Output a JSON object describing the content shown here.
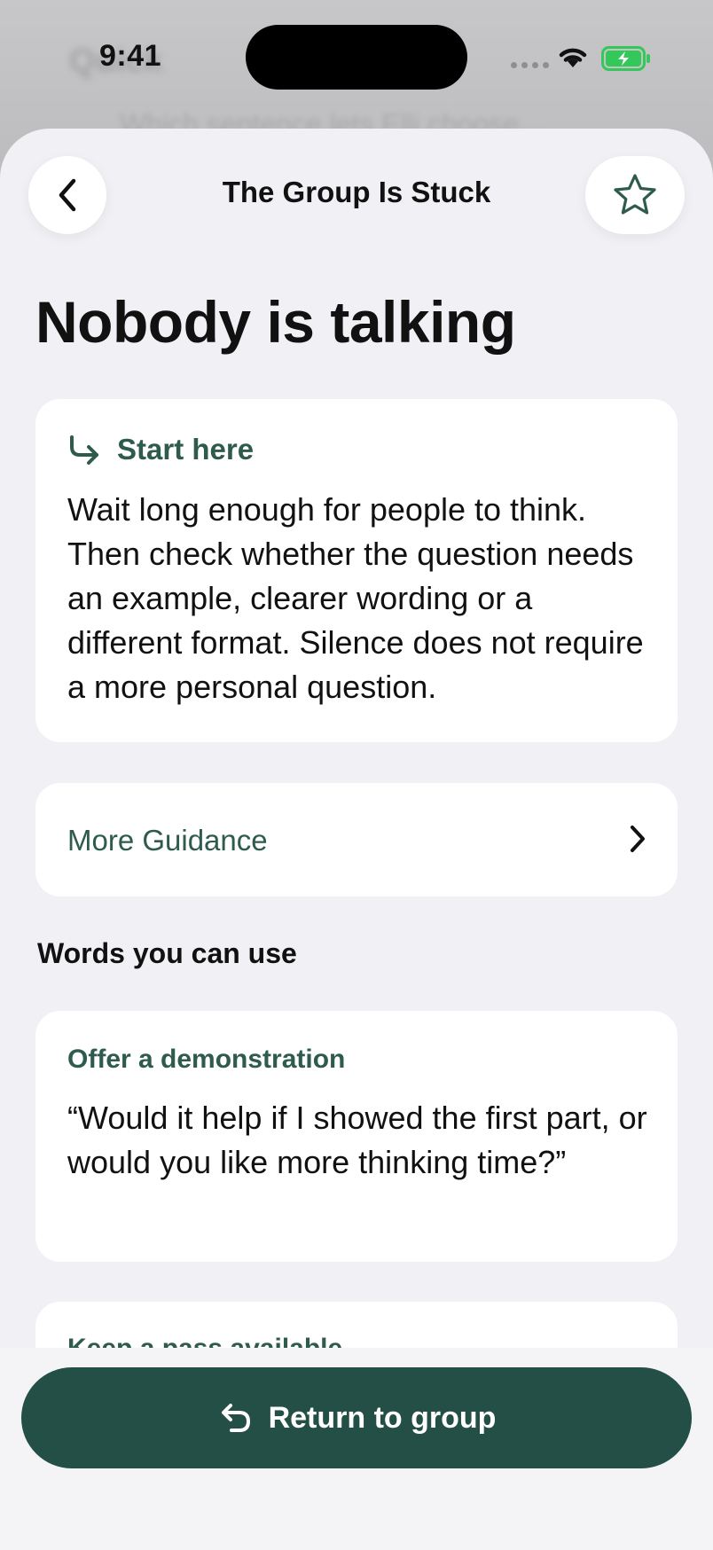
{
  "status_bar": {
    "time": "9:41"
  },
  "background": {
    "ghost_title": "Quick",
    "ghost_text": "Which sentence lets Elli choose..."
  },
  "nav": {
    "title": "The Group Is Stuck"
  },
  "page": {
    "title": "Nobody is talking"
  },
  "start_card": {
    "label": "Start here",
    "body": "Wait long enough for people to think. Then check whether the question needs an example, clearer wording or a different format. Silence does not require a more personal question."
  },
  "guidance": {
    "label": "More Guidance"
  },
  "words_section": {
    "heading": "Words you can use"
  },
  "phrases": [
    {
      "label": "Offer a demonstration",
      "text": "“Would it help if I showed the first part, or would you like more thinking time?”"
    },
    {
      "label": "Keep a pass available",
      "text": ""
    }
  ],
  "bottom": {
    "return_label": "Return to group"
  },
  "colors": {
    "accent": "#2e5b4e",
    "button": "#234f46",
    "sheet": "#f1f1f5",
    "battery": "#34c759"
  },
  "icons": {
    "back": "chevron-left-icon",
    "favorite": "star-outline-icon",
    "start": "turn-right-arrow-icon",
    "more": "chevron-right-icon",
    "return": "return-arrow-icon"
  }
}
